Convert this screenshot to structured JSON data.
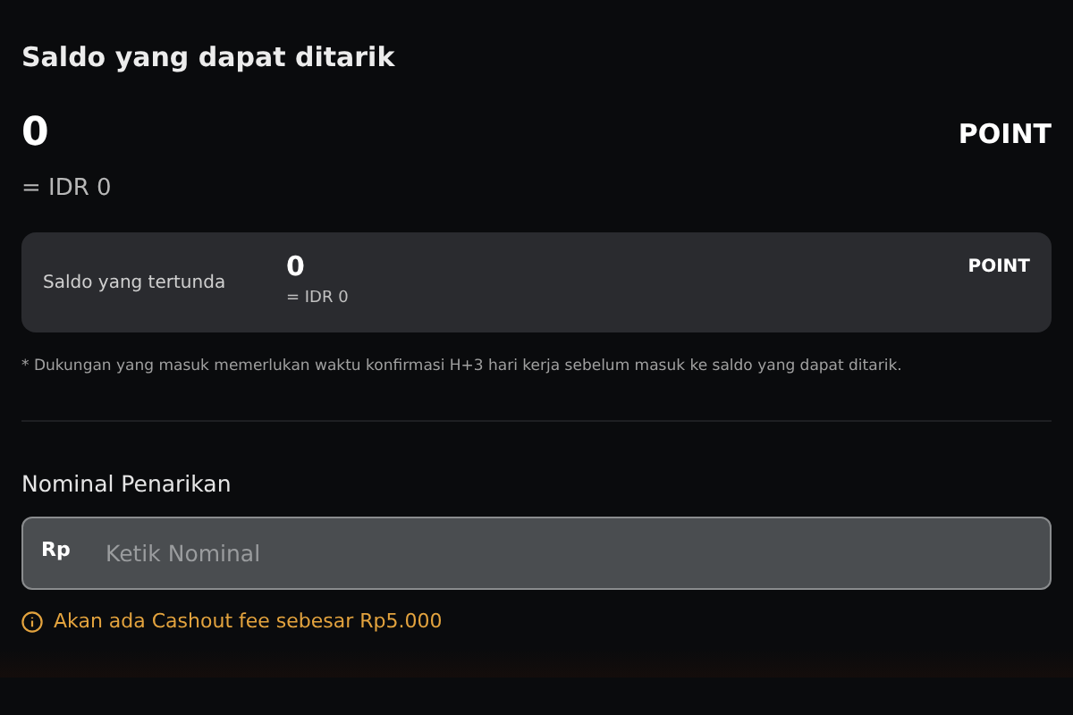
{
  "title": "Saldo yang dapat ditarik",
  "available": {
    "amount": "0",
    "unit": "POINT",
    "idr": "= IDR 0"
  },
  "pending": {
    "label": "Saldo yang tertunda",
    "amount": "0",
    "idr": "= IDR 0",
    "unit": "POINT"
  },
  "note": "* Dukungan yang masuk memerlukan waktu konfirmasi H+3 hari kerja sebelum masuk ke saldo yang dapat ditarik.",
  "withdraw": {
    "label": "Nominal Penarikan",
    "prefix": "Rp",
    "placeholder": "Ketik Nominal"
  },
  "warning": "Akan ada Cashout fee sebesar Rp5.000"
}
